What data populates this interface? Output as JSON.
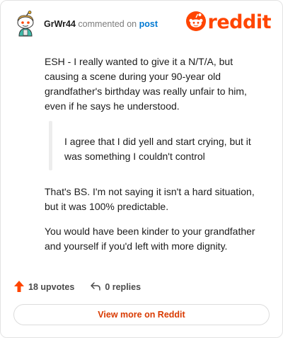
{
  "header": {
    "username": "GrWr44",
    "action_text": "commented on",
    "post_link": "post",
    "brand": "reddit",
    "brand_color": "#ff4500",
    "avatar_icon": "snoo-avatar-icon"
  },
  "comment": {
    "paragraph_1": "ESH - I really wanted to give it a N/T/A, but causing a scene during your 90-year old grandfather's birthday was really unfair to him, even if he says he understood.",
    "quote": "I agree that I did yell and start crying, but it was something I couldn't control",
    "paragraph_2": "That's BS. I'm not saying it isn't a hard situation, but it was 100% predictable.",
    "paragraph_3": "You would have been kinder to your grandfather and yourself if you'd left with more dignity."
  },
  "stats": {
    "upvotes": "18 upvotes",
    "replies": "0 replies",
    "upvote_icon": "upvote-arrow-icon",
    "reply_icon": "reply-arrow-icon"
  },
  "footer": {
    "view_more_label": "View more on Reddit",
    "accent_color": "#d93a00"
  }
}
